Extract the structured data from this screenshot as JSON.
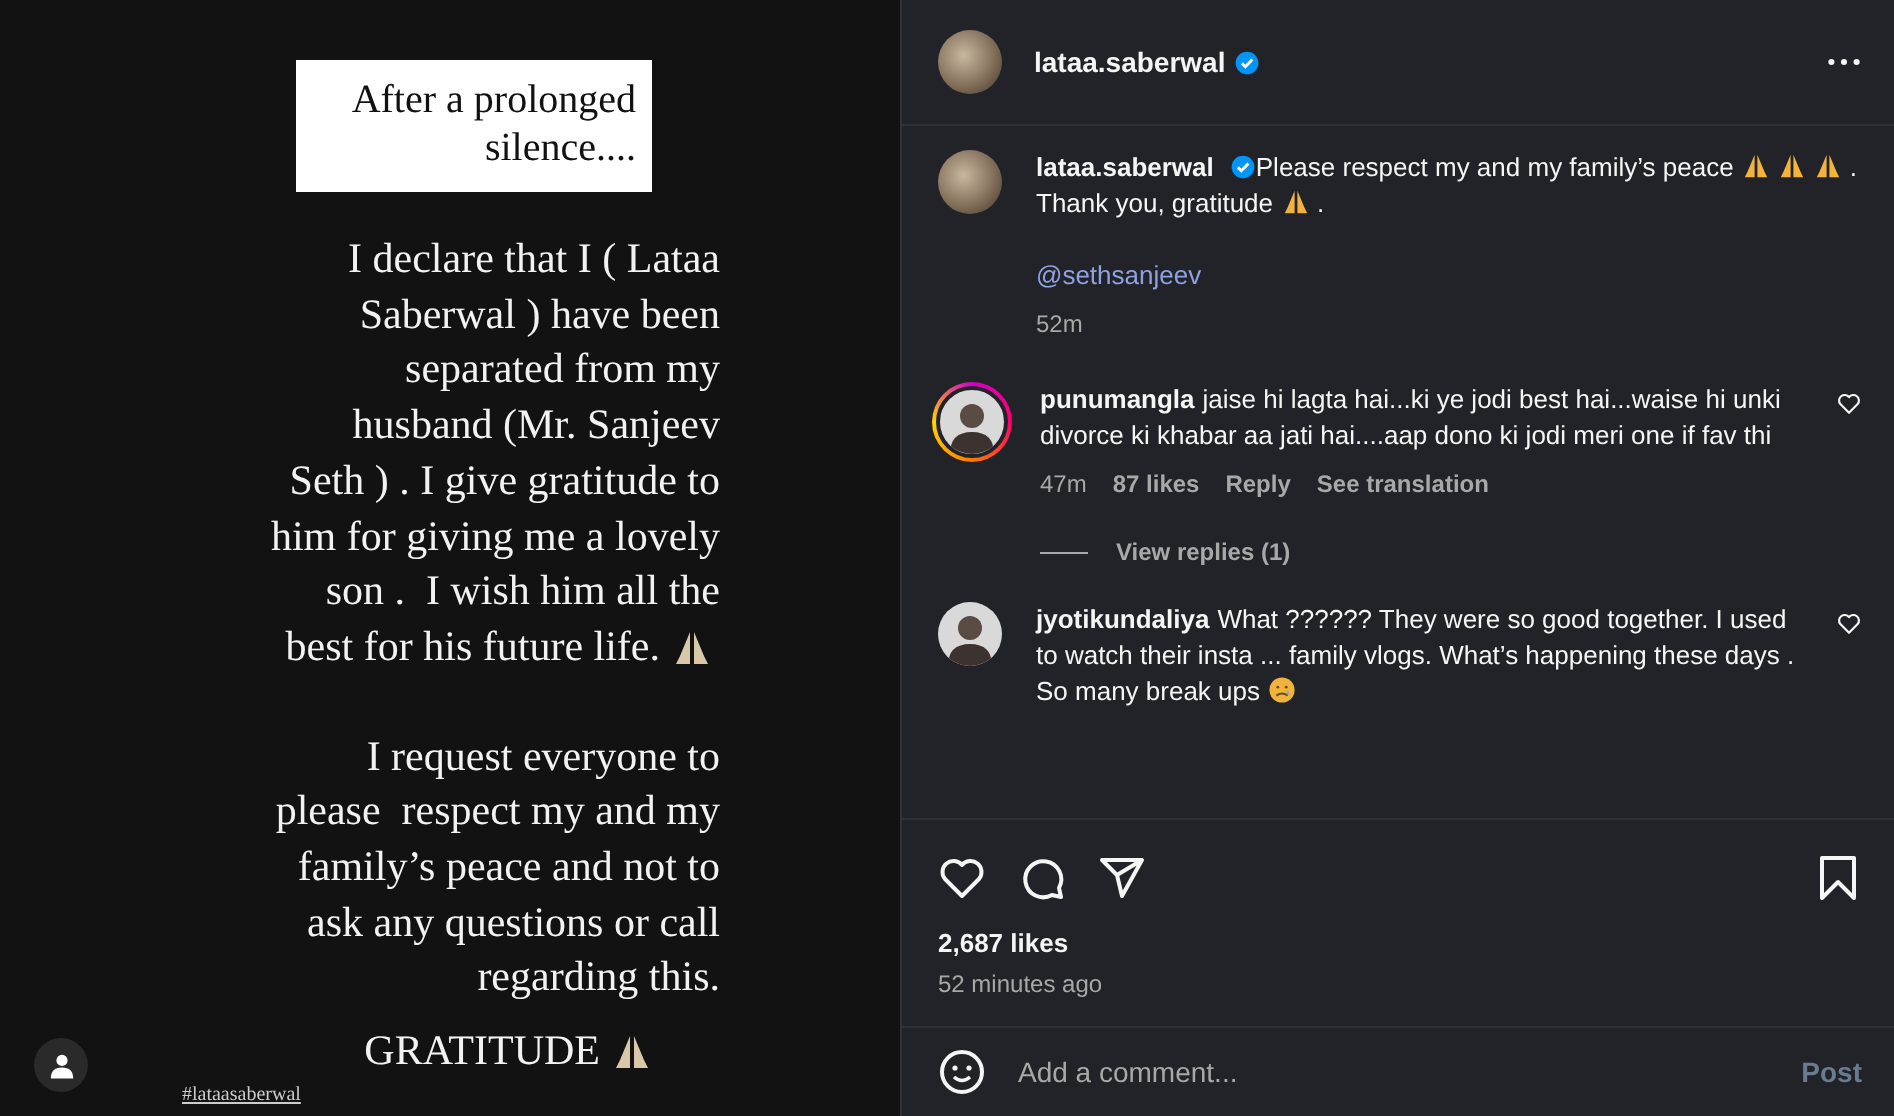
{
  "story": {
    "heading": "After a prolonged silence....",
    "paragraphs": [
      [
        {
          "text": "I declare that I ( Lataa"
        },
        {
          "text": "Saberwal ) have been"
        },
        {
          "text": "separated from my"
        },
        {
          "text": "husband (Mr. Sanjeev"
        },
        {
          "text": "Seth ) . I give gratitude to"
        },
        {
          "text": "him for giving me a lovely"
        },
        {
          "text": "son .  I wish him all the"
        },
        {
          "text": "best for his future life.",
          "praying_hands": true
        }
      ],
      [
        {
          "text": "I request everyone to"
        },
        {
          "text": "please  respect my and my"
        },
        {
          "text": "family’s peace and not to"
        },
        {
          "text": "ask any questions or call"
        },
        {
          "text": "regarding this."
        }
      ],
      [
        {
          "text": "GRATITUDE",
          "praying_hands": true
        }
      ]
    ],
    "tag": "#lataasaberwal"
  },
  "post": {
    "username": "lataa.saberwal",
    "verified": true,
    "caption": {
      "username": "lataa.saberwal",
      "verified": true,
      "segments": [
        {
          "kind": "text",
          "text": "Please respect my and my family’s peace"
        },
        {
          "kind": "praying"
        },
        {
          "kind": "praying"
        },
        {
          "kind": "praying"
        },
        {
          "kind": "text",
          "text": ". Thank you, gratitude"
        },
        {
          "kind": "praying"
        },
        {
          "kind": "text",
          "text": "."
        }
      ],
      "mention": "@sethsanjeev",
      "time": "52m"
    },
    "comments": [
      {
        "username": "punumangla",
        "story_ring": true,
        "text": "jaise hi lagta hai...ki ye jodi best hai...waise hi unki divorce ki khabar aa jati hai....aap dono ki jodi meri one if fav thi",
        "emoji": false,
        "time": "47m",
        "likes": "87 likes",
        "reply": "Reply",
        "translation": "See translation",
        "view_replies": "View replies (1)"
      },
      {
        "username": "jyotikundaliya",
        "story_ring": false,
        "text": "What ?????? They were so good together. I used to watch their insta ... family vlogs. What’s happening these days . So many break ups",
        "emoji": true
      }
    ],
    "likes": "2,687 likes",
    "time_ago": "52 minutes ago",
    "comment_field": {
      "placeholder": "Add a comment...",
      "button": "Post"
    }
  }
}
